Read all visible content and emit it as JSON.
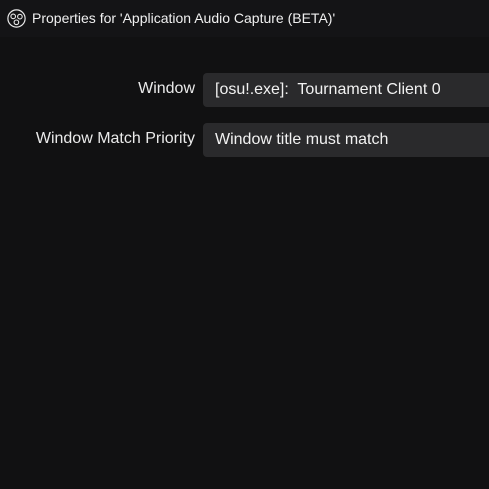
{
  "titlebar": {
    "app_icon": "obs-logo-icon",
    "title": "Properties for 'Application Audio Capture (BETA)'"
  },
  "form": {
    "window": {
      "label": "Window",
      "value": "[osu!.exe]:  Tournament Client 0"
    },
    "priority": {
      "label": "Window Match Priority",
      "value": "Window title must match"
    }
  }
}
